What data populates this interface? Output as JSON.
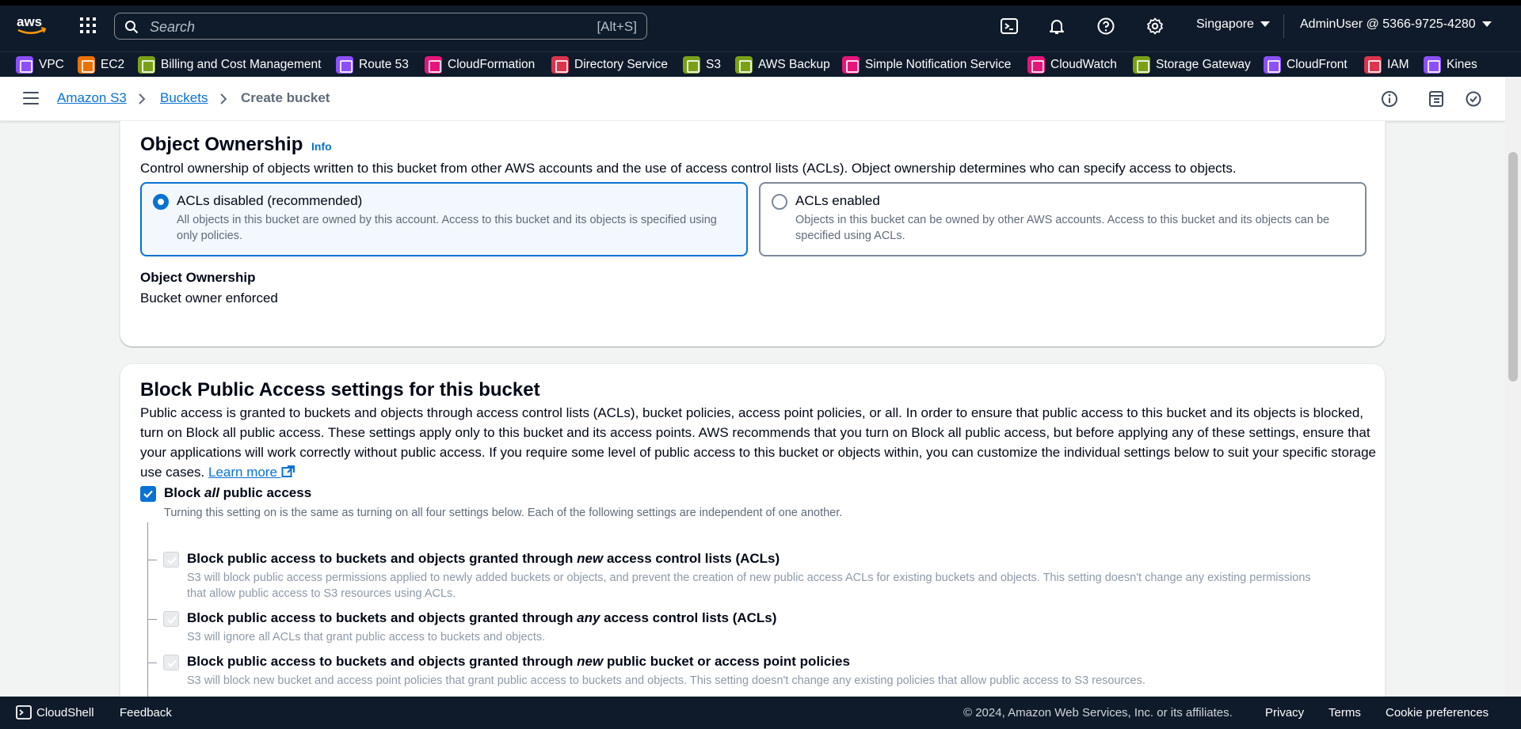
{
  "topnav": {
    "search_placeholder": "Search",
    "search_shortcut": "[Alt+S]",
    "region": "Singapore",
    "account": "AdminUser @ 5366-9725-4280"
  },
  "favorites": [
    {
      "label": "VPC",
      "color": "#8c4fff"
    },
    {
      "label": "EC2",
      "color": "#ed7100"
    },
    {
      "label": "Billing and Cost Management",
      "color": "#7aa116"
    },
    {
      "label": "Route 53",
      "color": "#8c4fff"
    },
    {
      "label": "CloudFormation",
      "color": "#e7157b"
    },
    {
      "label": "Directory Service",
      "color": "#dd344c"
    },
    {
      "label": "S3",
      "color": "#7aa116"
    },
    {
      "label": "AWS Backup",
      "color": "#7aa116"
    },
    {
      "label": "Simple Notification Service",
      "color": "#e7157b"
    },
    {
      "label": "CloudWatch",
      "color": "#e7157b"
    },
    {
      "label": "Storage Gateway",
      "color": "#7aa116"
    },
    {
      "label": "CloudFront",
      "color": "#8c4fff"
    },
    {
      "label": "IAM",
      "color": "#dd344c"
    },
    {
      "label": "Kines",
      "color": "#8c4fff"
    }
  ],
  "breadcrumb": {
    "items": [
      "Amazon S3",
      "Buckets"
    ],
    "current": "Create bucket"
  },
  "ownership": {
    "title": "Object Ownership",
    "info": "Info",
    "description": "Control ownership of objects written to this bucket from other AWS accounts and the use of access control lists (ACLs). Object ownership determines who can specify access to objects.",
    "options": [
      {
        "label": "ACLs disabled (recommended)",
        "desc": "All objects in this bucket are owned by this account. Access to this bucket and its objects is specified using only policies.",
        "selected": true
      },
      {
        "label": "ACLs enabled",
        "desc": "Objects in this bucket can be owned by other AWS accounts. Access to this bucket and its objects can be specified using ACLs.",
        "selected": false
      }
    ],
    "kv_label": "Object Ownership",
    "kv_value": "Bucket owner enforced"
  },
  "bpa": {
    "title": "Block Public Access settings for this bucket",
    "description": "Public access is granted to buckets and objects through access control lists (ACLs), bucket policies, access point policies, or all. In order to ensure that public access to this bucket and its objects is blocked, turn on Block all public access. These settings apply only to this bucket and its access points. AWS recommends that you turn on Block all public access, but before applying any of these settings, ensure that your applications will work correctly without public access. If you require some level of public access to this bucket or objects within, you can customize the individual settings below to suit your specific storage use cases.",
    "learn_more": "Learn more",
    "block_all": {
      "pre": "Block ",
      "em": "all",
      "post": " public access",
      "desc": "Turning this setting on is the same as turning on all four settings below. Each of the following settings are independent of one another.",
      "checked": true
    },
    "options": [
      {
        "pre": "Block public access to buckets and objects granted through ",
        "em": "new",
        "post": " access control lists (ACLs)",
        "desc": "S3 will block public access permissions applied to newly added buckets or objects, and prevent the creation of new public access ACLs for existing buckets and objects. This setting doesn't change any existing permissions that allow public access to S3 resources using ACLs."
      },
      {
        "pre": "Block public access to buckets and objects granted through ",
        "em": "any",
        "post": " access control lists (ACLs)",
        "desc": "S3 will ignore all ACLs that grant public access to buckets and objects."
      },
      {
        "pre": "Block public access to buckets and objects granted through ",
        "em": "new",
        "post": " public bucket or access point policies",
        "desc": "S3 will block new bucket and access point policies that grant public access to buckets and objects. This setting doesn't change any existing policies that allow public access to S3 resources."
      }
    ]
  },
  "footer": {
    "cloudshell": "CloudShell",
    "feedback": "Feedback",
    "copyright": "© 2024, Amazon Web Services, Inc. or its affiliates.",
    "privacy": "Privacy",
    "terms": "Terms",
    "cookies": "Cookie preferences"
  }
}
